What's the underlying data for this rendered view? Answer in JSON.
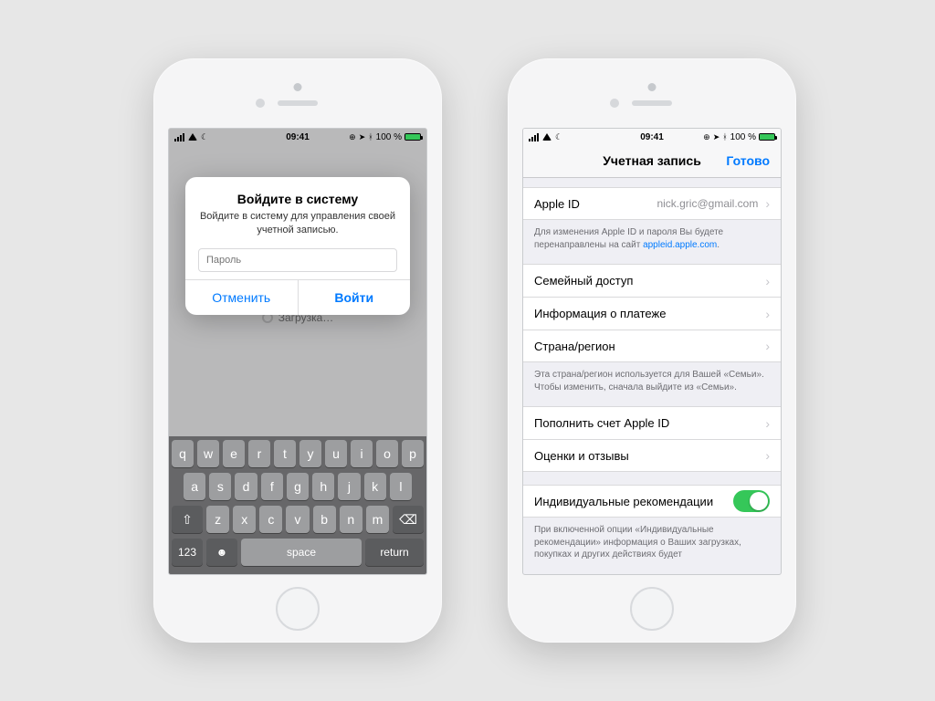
{
  "status": {
    "time": "09:41",
    "battery": "100 %"
  },
  "left": {
    "loading": "Загрузка…",
    "alert": {
      "title": "Войдите в систему",
      "body": "Войдите в систему для управления своей учетной записью.",
      "placeholder": "Пароль",
      "cancel": "Отменить",
      "ok": "Войти"
    },
    "keyboard": {
      "r1": [
        "q",
        "w",
        "e",
        "r",
        "t",
        "y",
        "u",
        "i",
        "o",
        "p"
      ],
      "r2": [
        "a",
        "s",
        "d",
        "f",
        "g",
        "h",
        "j",
        "k",
        "l"
      ],
      "r3": [
        "z",
        "x",
        "c",
        "v",
        "b",
        "n",
        "m"
      ],
      "num": "123",
      "space": "space",
      "ret": "return"
    }
  },
  "right": {
    "nav": {
      "title": "Учетная запись",
      "done": "Готово"
    },
    "rows": {
      "apple_id_label": "Apple ID",
      "apple_id_value": "nick.gric@gmail.com",
      "apple_id_foot_pre": "Для изменения Apple ID и пароля Вы будете перенаправлены на сайт ",
      "apple_id_foot_link": "appleid.apple.com",
      "family": "Семейный доступ",
      "payment": "Информация о платеже",
      "region": "Страна/регион",
      "region_foot": "Эта страна/регион используется для Вашей «Семьи». Чтобы изменить, сначала выйдите из «Семьи».",
      "fund": "Пополнить счет Apple ID",
      "reviews": "Оценки и отзывы",
      "recs": "Индивидуальные рекомендации",
      "recs_foot": "При включенной опции «Индивидуальные рекомендации» информация о Ваших загрузках, покупках и других действиях будет"
    }
  }
}
